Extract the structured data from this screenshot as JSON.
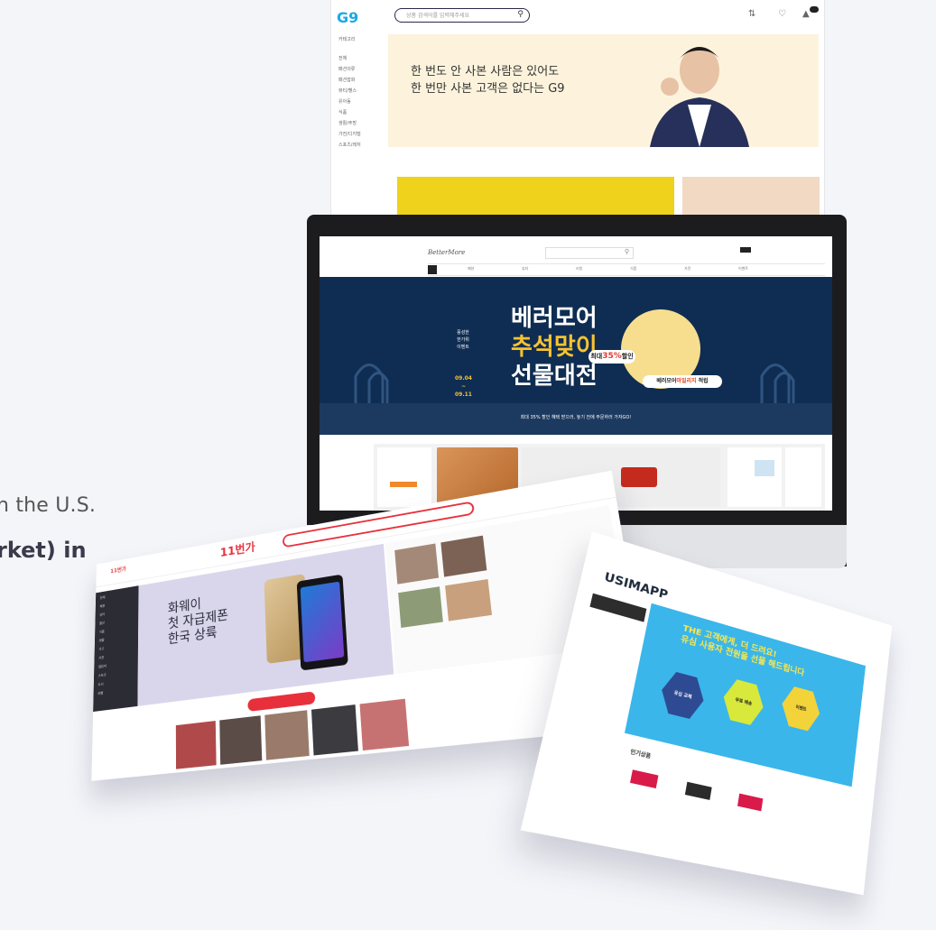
{
  "left_text": {
    "line1": "n the U.S.",
    "line2": "rket) in"
  },
  "g9": {
    "logo": "G9",
    "search_placeholder": "상품 검색어를 입력해주세요",
    "sidebar": [
      "카테고리",
      "전체",
      "패션의류",
      "패션잡화",
      "뷰티/헬스",
      "유아동",
      "식품",
      "생활/주방",
      "가전/디지털",
      "스포츠/레저"
    ],
    "headline_line1": "한 번도 안 사본 사람은 있어도",
    "headline_line2": "한 번만 사본 고객은 없다는 G9"
  },
  "bettermore": {
    "logo": "BetterMore",
    "nav": [
      "패션",
      "뷰티",
      "리빙",
      "식품",
      "가전",
      "이벤트"
    ],
    "side_text": "풍성한 한가위 이벤트",
    "date_from": "09.04",
    "date_sep": "~",
    "date_to": "09.11",
    "title_line1": "베러모어",
    "title_line2": "추석맞이",
    "title_line3": "선물대전",
    "pill1_prefix": "최대",
    "pill1_pct": "35%",
    "pill1_suffix": "할인",
    "pill2_prefix": "베러모어",
    "pill2_highlight": "마일리지",
    "pill2_suffix": "적립",
    "strip": "최대 35% 할인 혜택 받으러, 놓기 전에 주문하러 가자GO!"
  },
  "elevenst": {
    "logo": "11번가",
    "big_logo": "11번가",
    "hero_title_line1": "화웨이",
    "hero_title_line2": "첫 자급제폰",
    "hero_title_line3": "한국 상륙",
    "side_items": [
      "전체",
      "패션",
      "뷰티",
      "출산",
      "식품",
      "생활",
      "가구",
      "가전",
      "컴퓨터",
      "스포츠",
      "도서",
      "여행"
    ]
  },
  "usimapp": {
    "logo": "USIMAPP",
    "hero_title_line1": "THE 고객에게, 더 드려요!",
    "hero_title_line2": "유심 사용자 전원을 선물 해드립니다",
    "hex1": "유심 교체",
    "hex2": "무료 배송",
    "hex3": "이벤트",
    "section_title": "인기상품"
  },
  "colors": {
    "accent_red": "#e8303c",
    "bettermore_navy": "#0f2d52",
    "bettermore_gold": "#f7c331",
    "g9_blue": "#1aa9e6",
    "usim_blue": "#3ab6ea"
  }
}
